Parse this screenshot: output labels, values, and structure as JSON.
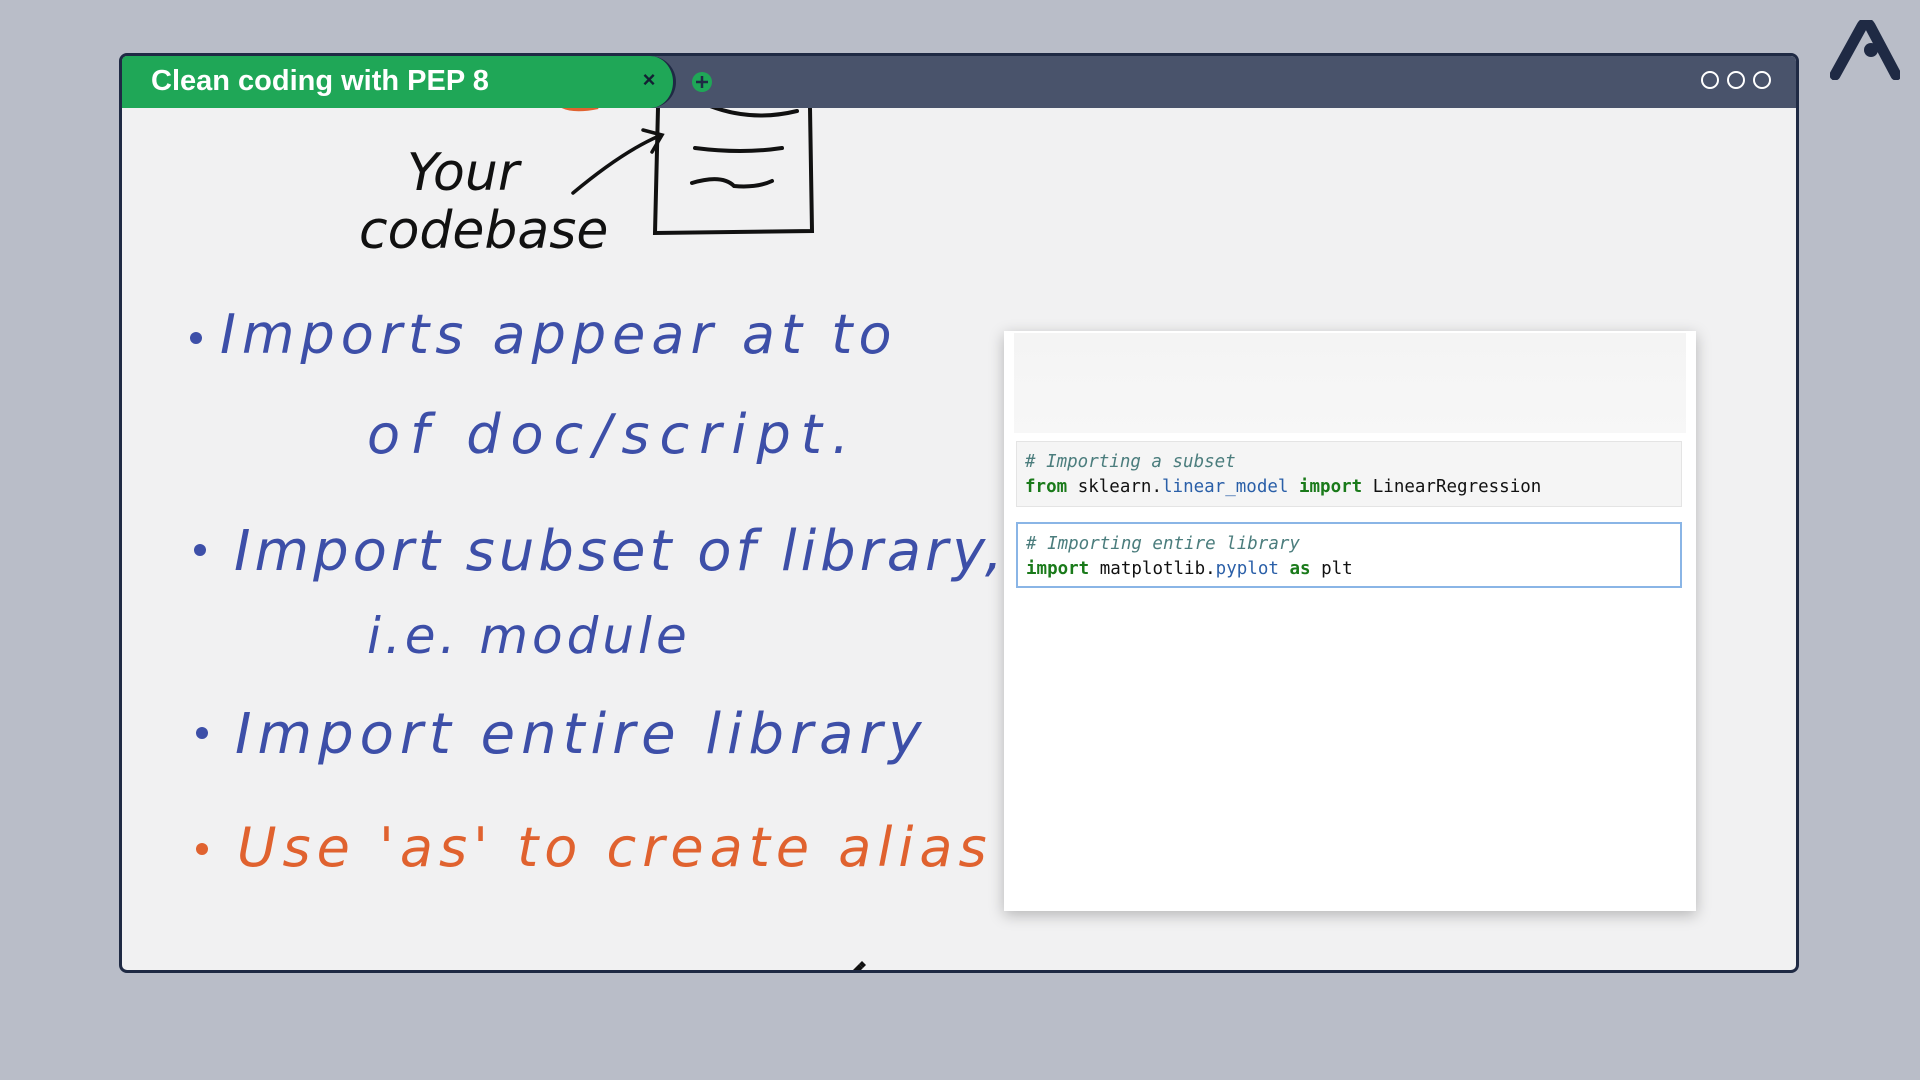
{
  "window": {
    "tab_title": "Clean coding with PEP 8",
    "close_symbol": "×",
    "add_tab_icon": "plus-circle-icon",
    "window_controls": [
      "circle",
      "circle",
      "circle"
    ]
  },
  "whiteboard": {
    "codebase_label_line1": "Your",
    "codebase_label_line2": "codebase",
    "bullets": [
      {
        "line1": "Imports appear at to",
        "line2": "of doc/script.",
        "color": "#3d4fa8"
      },
      {
        "line1": "Import subset of library,",
        "line2": "i.e. module",
        "color": "#3d4fa8"
      },
      {
        "line1": "Import entire library",
        "line2": "",
        "color": "#3d4fa8"
      },
      {
        "line1": "Use 'as' to create alias",
        "line2": "",
        "color": "#e0622f"
      }
    ]
  },
  "notebook": {
    "cells": [
      {
        "comment": "# Importing a subset",
        "kw1": "from",
        "module": "sklearn.",
        "attr": "linear_model",
        "kw2": "import",
        "name": "LinearRegression"
      },
      {
        "comment": "# Importing entire library",
        "kw1": "import",
        "module": "matplotlib.",
        "attr": "pyplot",
        "kw2": "as",
        "name": "plt"
      }
    ]
  },
  "colors": {
    "tab_green": "#1fa757",
    "titlebar": "#49536b",
    "ink_blue": "#3d4fa8",
    "ink_orange": "#e0622f",
    "background": "#b9bdc8"
  }
}
